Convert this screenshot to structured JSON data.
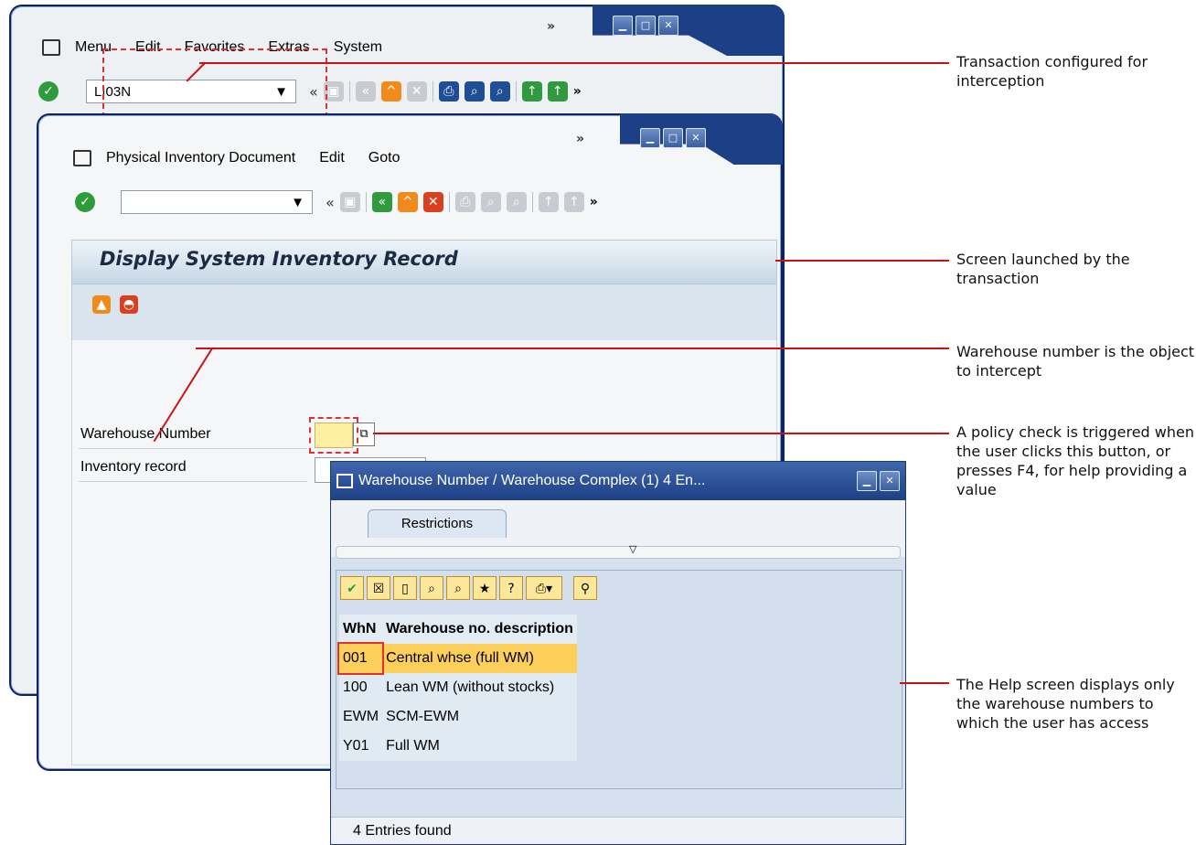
{
  "win1": {
    "menu": [
      "Menu",
      "Edit",
      "Favorites",
      "Extras",
      "System"
    ],
    "command": "LI03N"
  },
  "win2": {
    "menu": [
      "Physical Inventory Document",
      "Edit",
      "Goto"
    ],
    "command": "",
    "panel_title": "Display System Inventory Record",
    "fields": [
      {
        "label": "Warehouse Number",
        "value": ""
      },
      {
        "label": "Inventory record",
        "value": ""
      }
    ]
  },
  "popup": {
    "title": "Warehouse Number / Warehouse Complex (1)  4 En...",
    "tab": "Restrictions",
    "columns": [
      "WhN",
      "Warehouse no. description"
    ],
    "rows": [
      {
        "code": "001",
        "desc": "Central whse (full WM)",
        "selected": true
      },
      {
        "code": "100",
        "desc": "Lean WM (without stocks)",
        "selected": false
      },
      {
        "code": "EWM",
        "desc": "SCM-EWM",
        "selected": false
      },
      {
        "code": "Y01",
        "desc": "Full WM",
        "selected": false
      }
    ],
    "status": "4 Entries found"
  },
  "callouts": [
    "Transaction configured for interception",
    "Screen launched by the transaction",
    "Warehouse number is the object to intercept",
    "A policy check is triggered when the user clicks this button, or presses F4, for help providing a value",
    "The Help screen displays only the warehouse numbers to which the user has access"
  ],
  "colors": {
    "accent": "#1d3f86",
    "callout_line": "#cc1111",
    "selection": "#fbcf5a"
  }
}
